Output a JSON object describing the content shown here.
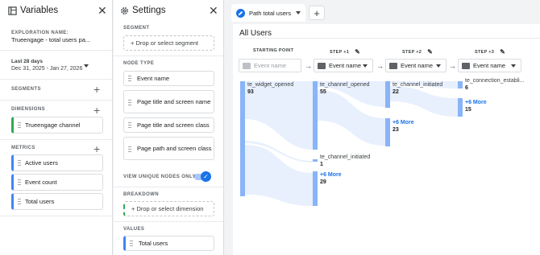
{
  "variables": {
    "title": "Variables",
    "exploration_label": "EXPLORATION NAME:",
    "exploration_name": "Trueengage - total users pa...",
    "date_range_label": "Last 28 days",
    "date_range": "Dec 31, 2025 - Jan 27, 2026",
    "segments_label": "SEGMENTS",
    "dimensions_label": "DIMENSIONS",
    "dimensions": [
      "Trueengage channel"
    ],
    "metrics_label": "METRICS",
    "metrics": [
      "Active users",
      "Event count",
      "Total users"
    ]
  },
  "settings": {
    "title": "Settings",
    "segment_label": "SEGMENT",
    "segment_placeholder": "+ Drop or select segment",
    "node_type_label": "NODE TYPE",
    "node_types": [
      "Event name",
      "Page title and screen name",
      "Page title and screen class",
      "Page path and screen class"
    ],
    "view_unique_label": "VIEW UNIQUE NODES ONLY",
    "breakdown_label": "BREAKDOWN",
    "breakdown_placeholder": "+ Drop or select dimension",
    "values_label": "VALUES",
    "values": [
      "Total users"
    ]
  },
  "canvas": {
    "tab_label": "Path total users",
    "add_tab": "+",
    "segment_title": "All Users",
    "columns": [
      {
        "header": "STARTING POINT",
        "select": "Event name",
        "placeholder": true
      },
      {
        "header": "STEP +1",
        "select": "Event name"
      },
      {
        "header": "STEP +2",
        "select": "Event name"
      },
      {
        "header": "STEP +3",
        "select": "Event name"
      }
    ],
    "nodes": {
      "start": {
        "label": "te_widget_opened",
        "count": "93"
      },
      "s1a": {
        "label": "te_channel_opened",
        "count": "55"
      },
      "s1b": {
        "label": "te_channel_initiated",
        "count": "1"
      },
      "s1c": {
        "more": "+6 More",
        "count": "29"
      },
      "s2a": {
        "label": "te_channel_initiated",
        "count": "22"
      },
      "s2b": {
        "more": "+6 More",
        "count": "23"
      },
      "s3a": {
        "label": "te_connection_establi...",
        "count": "6"
      },
      "s3b": {
        "more": "+6 More",
        "count": "15"
      }
    }
  },
  "colors": {
    "bar": "#8ab4f8",
    "link": "#1a73e8",
    "accent_green": "#34a853"
  }
}
